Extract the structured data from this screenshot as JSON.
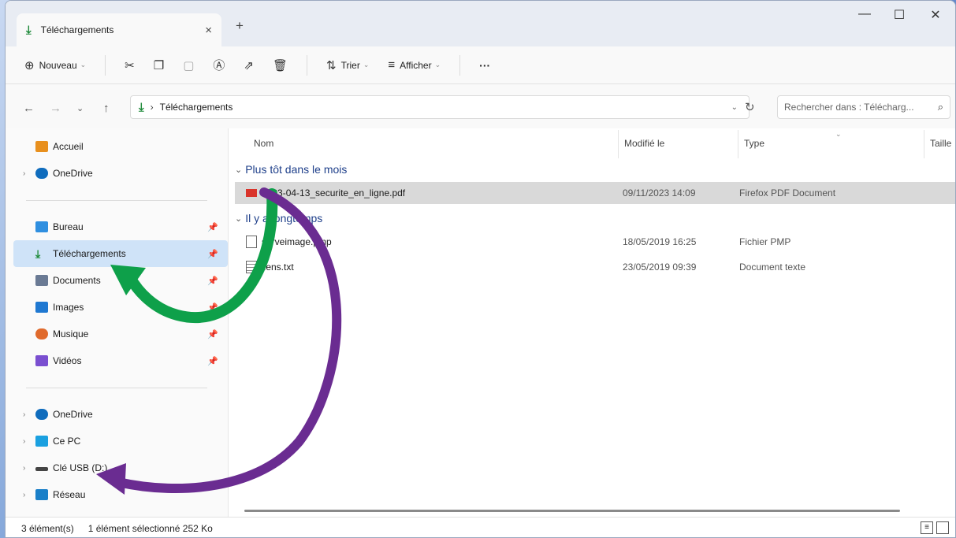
{
  "window": {
    "tab_title": "Téléchargements",
    "tab_close": "×",
    "new_tab": "+",
    "controls": {
      "minimize": "—",
      "maximize": "☐",
      "close": "✕"
    }
  },
  "toolbar": {
    "new_label": "Nouveau",
    "sort_label": "Trier",
    "view_label": "Afficher",
    "more_label": "···"
  },
  "address": {
    "path": "Téléchargements",
    "separator": "›",
    "search_placeholder": "Rechercher dans : Télécharg..."
  },
  "sidebar": {
    "home": "Accueil",
    "onedrive_top": "OneDrive",
    "pinned": [
      {
        "label": "Bureau",
        "icon": "desktop-icon",
        "color": "#2f8fe0"
      },
      {
        "label": "Téléchargements",
        "icon": "download-icon",
        "color": "#1e8a3a"
      },
      {
        "label": "Documents",
        "icon": "document-icon",
        "color": "#6a7a94"
      },
      {
        "label": "Images",
        "icon": "image-icon",
        "color": "#1f78d1"
      },
      {
        "label": "Musique",
        "icon": "music-icon",
        "color": "#e06a2c"
      },
      {
        "label": "Vidéos",
        "icon": "video-icon",
        "color": "#7a4fd0"
      }
    ],
    "locations": [
      {
        "label": "OneDrive",
        "icon": "cloud-icon",
        "color": "#0f6cbd"
      },
      {
        "label": "Ce PC",
        "icon": "computer-icon",
        "color": "#1aa0e0"
      },
      {
        "label": "Clé USB (D:)",
        "icon": "usb-drive-icon",
        "color": "#444444"
      },
      {
        "label": "Réseau",
        "icon": "network-icon",
        "color": "#1a7fc8"
      }
    ]
  },
  "columns": {
    "name": "Nom",
    "modified": "Modifié le",
    "type": "Type",
    "size": "Taille"
  },
  "groups": [
    {
      "label": "Plus tôt dans le mois",
      "files": [
        {
          "name": "2023-04-13_securite_en_ligne.pdf",
          "modified": "09/11/2023 14:09",
          "type": "Firefox PDF Document",
          "icon": "pdf-icon"
        }
      ]
    },
    {
      "label": "Il y a longtemps",
      "files": [
        {
          "name": "serveimage.pmp",
          "modified": "18/05/2019 16:25",
          "type": "Fichier PMP",
          "icon": "blank-file-icon"
        },
        {
          "name": "liens.txt",
          "modified": "23/05/2019 09:39",
          "type": "Document texte",
          "icon": "text-file-icon"
        }
      ]
    }
  ],
  "status": {
    "count": "3 élément(s)",
    "selection": "1 élément sélectionné  252 Ko"
  },
  "colors": {
    "accent": "#0f6cbd",
    "arrow_green": "#0ea04a",
    "arrow_purple": "#6a2c91"
  }
}
